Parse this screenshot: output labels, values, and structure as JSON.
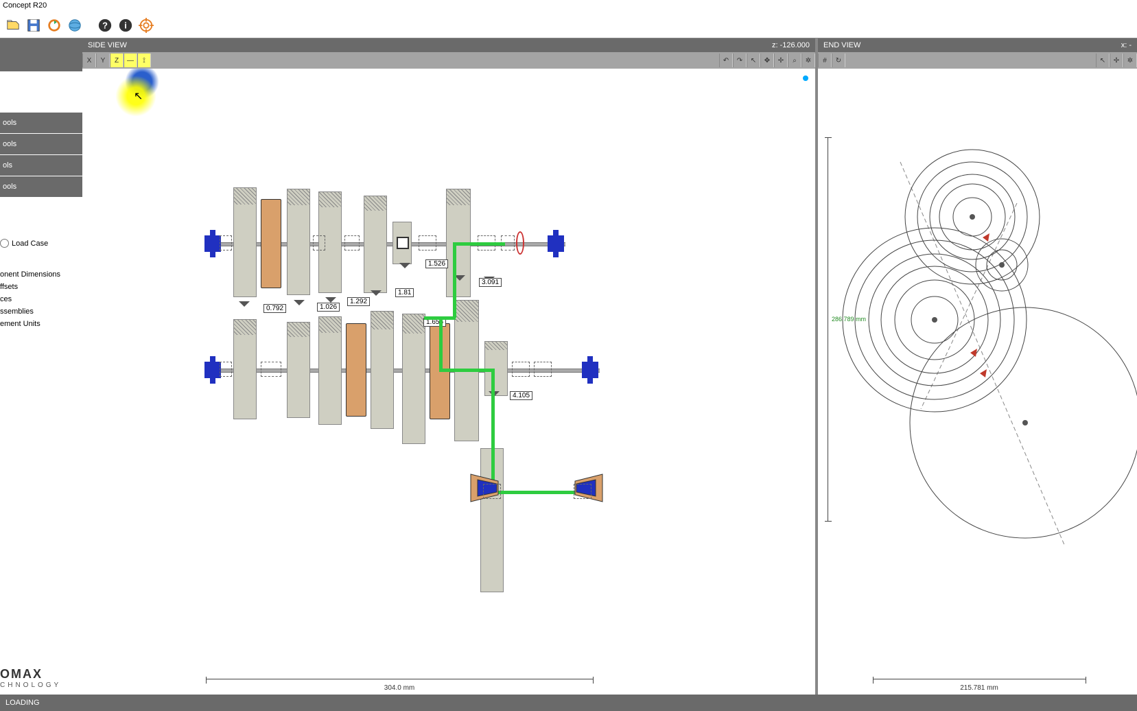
{
  "app": {
    "title": "Concept R20"
  },
  "views": {
    "side": {
      "title": "SIDE VIEW",
      "coord": "z: -126.000",
      "ruler": "304.0 mm"
    },
    "end": {
      "title": "END VIEW",
      "coord": "x: -",
      "ruler_h": "215.781 mm",
      "ruler_v": "286.789 mm"
    }
  },
  "sidebar": {
    "sections": [
      "ools",
      "ools",
      "ols",
      "ools"
    ],
    "radio": "Load Case",
    "links": [
      "onent Dimensions",
      "ffsets",
      "ces",
      "ssemblies",
      "ement Units"
    ]
  },
  "logo": {
    "line1": "OMAX",
    "line2": "CHNOLOGY"
  },
  "ratios": {
    "r1": "0.792",
    "r2": "1.026",
    "r3": "1.292",
    "r4": "1.526",
    "r5": "1.655",
    "r6": "1.81",
    "r7": "3.091",
    "r8": "4.105"
  },
  "status": "LOADING",
  "axis_buttons": {
    "x": "X",
    "y": "Y",
    "z": "Z"
  },
  "toolbar_symbols": {
    "undo": "↶",
    "redo": "↷",
    "cursor": "↖",
    "cross": "✥",
    "move": "✢",
    "zoom": "⌕",
    "gear": "✲",
    "grid": "#",
    "refresh": "↻"
  }
}
